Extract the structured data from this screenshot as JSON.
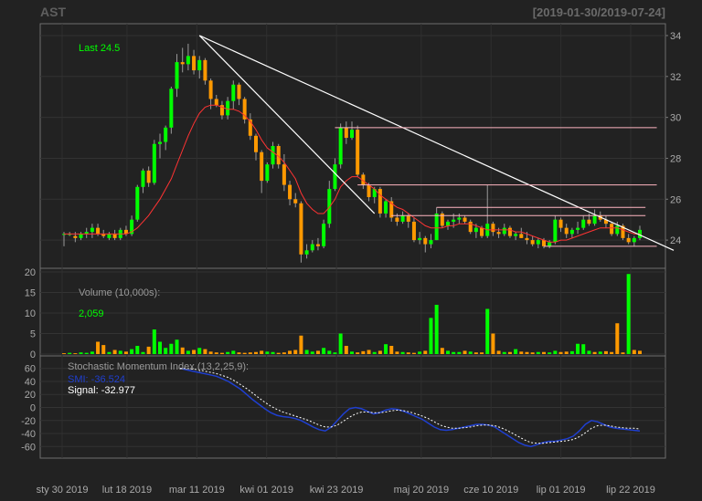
{
  "header": {
    "ticker": "AST",
    "date_range": "[2019-01-30/2019-07-24]"
  },
  "price_panel": {
    "last_label": "Last 24.5",
    "y_ticks": [
      "34",
      "32",
      "30",
      "28",
      "26",
      "24"
    ]
  },
  "volume_panel": {
    "title": "Volume (10,000s):",
    "last_value": "2,059",
    "y_ticks": [
      "20",
      "15",
      "10",
      "5",
      "0"
    ]
  },
  "smi_panel": {
    "title": "Stochastic Momentum Index (13,2,25,9):",
    "smi_label": "SMI: -36.524",
    "signal_label": "Signal: -32.977",
    "y_ticks": [
      "60",
      "40",
      "20",
      "0",
      "-20",
      "-40",
      "-60"
    ]
  },
  "x_axis": {
    "labels": [
      "sty 30 2019",
      "lut 18 2019",
      "mar 11 2019",
      "kwi 01 2019",
      "kwi 23 2019",
      "maj 20 2019",
      "cze 10 2019",
      "lip 01 2019",
      "lip 22 2019"
    ]
  },
  "colors": {
    "background": "#222222",
    "panel_border": "#777777",
    "up_candle": "#00ff00",
    "down_candle": "#ff9900",
    "ma_line": "#ff3333",
    "trend_line": "#ffffff",
    "resistance_line": "#ffb6c1",
    "smi_line": "#1f3fd0",
    "signal_line": "#ffffff"
  },
  "chart_data": {
    "type": "candlestick",
    "price": {
      "ylim": [
        22.8,
        34.4
      ],
      "last": 24.5,
      "candles": [
        {
          "o": 24.3,
          "h": 24.4,
          "l": 23.7,
          "c": 24.3
        },
        {
          "o": 24.3,
          "h": 24.4,
          "l": 24.2,
          "c": 24.3
        },
        {
          "o": 24.2,
          "h": 24.4,
          "l": 23.9,
          "c": 24.1
        },
        {
          "o": 24.1,
          "h": 24.4,
          "l": 24.0,
          "c": 24.3
        },
        {
          "o": 24.3,
          "h": 24.6,
          "l": 24.1,
          "c": 24.4
        },
        {
          "o": 24.4,
          "h": 24.8,
          "l": 24.1,
          "c": 24.6
        },
        {
          "o": 24.6,
          "h": 24.8,
          "l": 24.2,
          "c": 24.3
        },
        {
          "o": 24.3,
          "h": 24.5,
          "l": 24.1,
          "c": 24.2
        },
        {
          "o": 24.1,
          "h": 24.4,
          "l": 24.0,
          "c": 24.3
        },
        {
          "o": 24.3,
          "h": 24.5,
          "l": 24.0,
          "c": 24.1
        },
        {
          "o": 24.1,
          "h": 24.6,
          "l": 24.0,
          "c": 24.5
        },
        {
          "o": 24.5,
          "h": 24.7,
          "l": 24.2,
          "c": 24.3
        },
        {
          "o": 24.3,
          "h": 25.2,
          "l": 24.2,
          "c": 25.0
        },
        {
          "o": 25.0,
          "h": 26.7,
          "l": 24.9,
          "c": 26.6
        },
        {
          "o": 26.6,
          "h": 27.5,
          "l": 26.3,
          "c": 27.4
        },
        {
          "o": 27.4,
          "h": 27.6,
          "l": 26.6,
          "c": 26.8
        },
        {
          "o": 26.8,
          "h": 28.9,
          "l": 26.7,
          "c": 28.7
        },
        {
          "o": 28.7,
          "h": 29.2,
          "l": 28.0,
          "c": 28.8
        },
        {
          "o": 28.8,
          "h": 29.6,
          "l": 28.4,
          "c": 29.5
        },
        {
          "o": 29.5,
          "h": 31.5,
          "l": 29.2,
          "c": 31.4
        },
        {
          "o": 31.4,
          "h": 33.1,
          "l": 31.0,
          "c": 32.7
        },
        {
          "o": 32.7,
          "h": 33.4,
          "l": 32.2,
          "c": 32.6
        },
        {
          "o": 32.6,
          "h": 33.6,
          "l": 32.3,
          "c": 33.0
        },
        {
          "o": 33.0,
          "h": 33.3,
          "l": 32.1,
          "c": 32.3
        },
        {
          "o": 32.3,
          "h": 33.0,
          "l": 31.9,
          "c": 32.8
        },
        {
          "o": 32.8,
          "h": 32.9,
          "l": 31.6,
          "c": 31.8
        },
        {
          "o": 31.8,
          "h": 31.9,
          "l": 30.4,
          "c": 30.9
        },
        {
          "o": 30.9,
          "h": 31.1,
          "l": 30.5,
          "c": 30.6
        },
        {
          "o": 30.6,
          "h": 30.8,
          "l": 29.9,
          "c": 30.1
        },
        {
          "o": 30.1,
          "h": 31.0,
          "l": 29.9,
          "c": 30.8
        },
        {
          "o": 30.8,
          "h": 31.8,
          "l": 30.4,
          "c": 31.6
        },
        {
          "o": 31.6,
          "h": 31.7,
          "l": 30.6,
          "c": 30.9
        },
        {
          "o": 30.9,
          "h": 31.0,
          "l": 29.7,
          "c": 29.9
        },
        {
          "o": 29.9,
          "h": 30.2,
          "l": 28.9,
          "c": 29.1
        },
        {
          "o": 29.1,
          "h": 29.2,
          "l": 27.9,
          "c": 28.3
        },
        {
          "o": 28.3,
          "h": 28.4,
          "l": 26.3,
          "c": 26.9
        },
        {
          "o": 26.9,
          "h": 27.8,
          "l": 26.8,
          "c": 27.7
        },
        {
          "o": 27.7,
          "h": 28.8,
          "l": 27.5,
          "c": 28.6
        },
        {
          "o": 28.6,
          "h": 28.7,
          "l": 27.5,
          "c": 27.7
        },
        {
          "o": 27.7,
          "h": 28.2,
          "l": 26.4,
          "c": 26.7
        },
        {
          "o": 26.7,
          "h": 26.9,
          "l": 25.7,
          "c": 26.0
        },
        {
          "o": 26.0,
          "h": 26.3,
          "l": 25.6,
          "c": 25.8
        },
        {
          "o": 25.8,
          "h": 25.9,
          "l": 22.9,
          "c": 23.3
        },
        {
          "o": 23.3,
          "h": 23.8,
          "l": 23.1,
          "c": 23.5
        },
        {
          "o": 23.5,
          "h": 24.0,
          "l": 23.4,
          "c": 23.8
        },
        {
          "o": 23.8,
          "h": 24.1,
          "l": 23.5,
          "c": 23.7
        },
        {
          "o": 23.7,
          "h": 25.0,
          "l": 23.6,
          "c": 24.8
        },
        {
          "o": 24.8,
          "h": 26.9,
          "l": 24.6,
          "c": 26.5
        },
        {
          "o": 26.5,
          "h": 28.0,
          "l": 26.4,
          "c": 27.7
        },
        {
          "o": 27.7,
          "h": 29.7,
          "l": 27.5,
          "c": 29.5
        },
        {
          "o": 29.5,
          "h": 29.8,
          "l": 28.7,
          "c": 29.0
        },
        {
          "o": 29.0,
          "h": 29.8,
          "l": 28.9,
          "c": 29.4
        },
        {
          "o": 29.4,
          "h": 29.6,
          "l": 27.1,
          "c": 27.2
        },
        {
          "o": 27.2,
          "h": 27.3,
          "l": 26.5,
          "c": 26.7
        },
        {
          "o": 26.7,
          "h": 26.8,
          "l": 25.9,
          "c": 26.1
        },
        {
          "o": 26.1,
          "h": 26.6,
          "l": 25.8,
          "c": 26.5
        },
        {
          "o": 26.5,
          "h": 26.6,
          "l": 25.1,
          "c": 25.3
        },
        {
          "o": 25.3,
          "h": 26.0,
          "l": 25.1,
          "c": 25.9
        },
        {
          "o": 25.9,
          "h": 26.1,
          "l": 24.9,
          "c": 25.1
        },
        {
          "o": 25.1,
          "h": 25.3,
          "l": 24.7,
          "c": 24.9
        },
        {
          "o": 24.9,
          "h": 25.4,
          "l": 24.8,
          "c": 25.2
        },
        {
          "o": 25.2,
          "h": 25.3,
          "l": 24.6,
          "c": 24.9
        },
        {
          "o": 24.9,
          "h": 25.1,
          "l": 23.9,
          "c": 24.0
        },
        {
          "o": 24.0,
          "h": 24.4,
          "l": 23.8,
          "c": 24.1
        },
        {
          "o": 24.1,
          "h": 24.2,
          "l": 23.4,
          "c": 23.8
        },
        {
          "o": 23.8,
          "h": 24.3,
          "l": 23.6,
          "c": 24.0
        },
        {
          "o": 24.0,
          "h": 25.6,
          "l": 24.0,
          "c": 25.3
        },
        {
          "o": 25.3,
          "h": 25.4,
          "l": 24.6,
          "c": 24.7
        },
        {
          "o": 24.7,
          "h": 25.0,
          "l": 24.5,
          "c": 24.9
        },
        {
          "o": 24.9,
          "h": 25.3,
          "l": 24.6,
          "c": 25.0
        },
        {
          "o": 25.0,
          "h": 25.3,
          "l": 24.8,
          "c": 25.1
        },
        {
          "o": 25.1,
          "h": 25.2,
          "l": 24.8,
          "c": 24.9
        },
        {
          "o": 24.9,
          "h": 25.0,
          "l": 24.3,
          "c": 24.4
        },
        {
          "o": 24.4,
          "h": 24.8,
          "l": 24.1,
          "c": 24.6
        },
        {
          "o": 24.6,
          "h": 24.7,
          "l": 24.1,
          "c": 24.2
        },
        {
          "o": 24.2,
          "h": 26.7,
          "l": 24.1,
          "c": 24.8
        },
        {
          "o": 24.8,
          "h": 24.9,
          "l": 24.2,
          "c": 24.4
        },
        {
          "o": 24.4,
          "h": 24.6,
          "l": 24.1,
          "c": 24.3
        },
        {
          "o": 24.3,
          "h": 24.8,
          "l": 24.2,
          "c": 24.6
        },
        {
          "o": 24.6,
          "h": 24.7,
          "l": 24.1,
          "c": 24.2
        },
        {
          "o": 24.2,
          "h": 24.4,
          "l": 24.0,
          "c": 24.3
        },
        {
          "o": 24.3,
          "h": 24.6,
          "l": 24.1,
          "c": 24.1
        },
        {
          "o": 24.1,
          "h": 24.4,
          "l": 23.8,
          "c": 24.0
        },
        {
          "o": 24.0,
          "h": 24.2,
          "l": 23.7,
          "c": 23.8
        },
        {
          "o": 23.8,
          "h": 24.1,
          "l": 23.6,
          "c": 24.0
        },
        {
          "o": 24.0,
          "h": 24.1,
          "l": 23.6,
          "c": 23.7
        },
        {
          "o": 23.7,
          "h": 24.0,
          "l": 23.6,
          "c": 23.9
        },
        {
          "o": 23.9,
          "h": 25.2,
          "l": 23.8,
          "c": 25.0
        },
        {
          "o": 25.0,
          "h": 25.1,
          "l": 24.4,
          "c": 24.6
        },
        {
          "o": 24.6,
          "h": 24.8,
          "l": 24.1,
          "c": 24.3
        },
        {
          "o": 24.3,
          "h": 24.6,
          "l": 24.1,
          "c": 24.5
        },
        {
          "o": 24.5,
          "h": 24.9,
          "l": 24.3,
          "c": 24.6
        },
        {
          "o": 24.6,
          "h": 25.2,
          "l": 24.5,
          "c": 25.0
        },
        {
          "o": 25.0,
          "h": 25.3,
          "l": 24.7,
          "c": 24.8
        },
        {
          "o": 24.8,
          "h": 25.5,
          "l": 24.7,
          "c": 25.2
        },
        {
          "o": 25.2,
          "h": 25.4,
          "l": 24.9,
          "c": 25.0
        },
        {
          "o": 25.0,
          "h": 25.2,
          "l": 24.6,
          "c": 24.8
        },
        {
          "o": 24.8,
          "h": 24.9,
          "l": 24.2,
          "c": 24.3
        },
        {
          "o": 24.3,
          "h": 24.9,
          "l": 24.2,
          "c": 24.7
        },
        {
          "o": 24.7,
          "h": 24.8,
          "l": 24.0,
          "c": 24.1
        },
        {
          "o": 24.1,
          "h": 24.3,
          "l": 23.8,
          "c": 23.9
        },
        {
          "o": 23.9,
          "h": 24.2,
          "l": 23.7,
          "c": 24.1
        },
        {
          "o": 24.1,
          "h": 24.7,
          "l": 24.0,
          "c": 24.5
        }
      ],
      "moving_average": [
        24.3,
        24.3,
        24.3,
        24.3,
        24.3,
        24.3,
        24.3,
        24.3,
        24.3,
        24.3,
        24.3,
        24.3,
        24.4,
        24.6,
        24.9,
        25.2,
        25.6,
        26.0,
        26.5,
        27.0,
        27.7,
        28.4,
        29.1,
        29.7,
        30.2,
        30.5,
        30.6,
        30.6,
        30.5,
        30.4,
        30.4,
        30.3,
        30.1,
        29.8,
        29.4,
        28.9,
        28.5,
        28.3,
        28.1,
        27.8,
        27.4,
        27.0,
        26.3,
        25.8,
        25.5,
        25.3,
        25.3,
        25.6,
        26.0,
        26.6,
        26.9,
        27.1,
        27.1,
        26.9,
        26.7,
        26.5,
        26.2,
        26.0,
        25.8,
        25.6,
        25.5,
        25.3,
        25.1,
        24.9,
        24.7,
        24.6,
        24.6,
        24.6,
        24.7,
        24.7,
        24.8,
        24.8,
        24.8,
        24.7,
        24.6,
        24.5,
        24.5,
        24.5,
        24.5,
        24.5,
        24.4,
        24.4,
        24.3,
        24.2,
        24.1,
        24.0,
        23.9,
        23.9,
        24.0,
        24.0,
        24.1,
        24.2,
        24.3,
        24.4,
        24.5,
        24.6,
        24.6,
        24.6,
        24.6,
        24.5,
        24.4,
        24.3,
        24.3,
        24.2
      ],
      "trend_lines": [
        {
          "x1": 24,
          "y1": 34.0,
          "x2": 108,
          "y2": 23.5
        },
        {
          "x1": 24,
          "y1": 34.0,
          "x2": 55,
          "y2": 25.3
        }
      ],
      "resistance_lines": [
        {
          "x1": 48,
          "x2": 105,
          "y": 29.5
        },
        {
          "x1": 52,
          "x2": 105,
          "y": 26.7
        },
        {
          "x1": 66,
          "x2": 103,
          "y": 25.6
        },
        {
          "x1": 58,
          "x2": 103,
          "y": 25.2
        },
        {
          "x1": 85,
          "x2": 105,
          "y": 23.7
        }
      ]
    },
    "volume": {
      "ylim": [
        0,
        20
      ],
      "values": [
        0.2,
        0.3,
        0.2,
        0.4,
        0.3,
        0.6,
        3.0,
        2.2,
        0.5,
        1.0,
        0.8,
        0.6,
        1.2,
        2.0,
        0.5,
        1.8,
        6.0,
        3.0,
        1.5,
        2.5,
        3.5,
        1.6,
        0.8,
        1.0,
        1.5,
        1.2,
        0.6,
        0.4,
        0.3,
        0.5,
        0.8,
        0.4,
        0.3,
        0.4,
        0.5,
        0.8,
        0.6,
        0.5,
        0.3,
        0.4,
        0.8,
        1.0,
        4.5,
        1.0,
        0.6,
        0.8,
        1.5,
        0.8,
        0.4,
        5.0,
        2.0,
        0.6,
        0.4,
        0.7,
        1.0,
        0.5,
        0.8,
        2.4,
        2.0,
        0.6,
        0.5,
        0.4,
        0.3,
        0.6,
        0.8,
        8.8,
        12.0,
        1.5,
        0.8,
        0.5,
        0.5,
        0.8,
        0.6,
        0.4,
        0.4,
        11.0,
        5.0,
        0.8,
        0.5,
        0.5,
        1.2,
        0.6,
        0.5,
        0.4,
        0.5,
        0.5,
        0.4,
        0.8,
        0.5,
        0.6,
        0.7,
        2.5,
        2.4,
        0.8,
        0.5,
        0.6,
        0.7,
        0.5,
        7.5,
        0.4,
        19.5,
        1.0,
        0.8,
        0.5,
        0.4,
        0.6,
        0.5,
        0.5
      ],
      "up": [
        false,
        true,
        false,
        true,
        true,
        true,
        false,
        false,
        true,
        false,
        true,
        false,
        true,
        true,
        true,
        false,
        true,
        true,
        true,
        true,
        true,
        false,
        true,
        false,
        true,
        false,
        false,
        false,
        false,
        true,
        true,
        false,
        false,
        false,
        false,
        false,
        true,
        true,
        false,
        false,
        false,
        false,
        false,
        true,
        true,
        false,
        true,
        true,
        true,
        true,
        false,
        true,
        false,
        false,
        false,
        true,
        false,
        true,
        false,
        false,
        true,
        false,
        false,
        true,
        false,
        true,
        true,
        false,
        true,
        true,
        true,
        false,
        true,
        false,
        false,
        true,
        false,
        false,
        true,
        false,
        true,
        false,
        false,
        false,
        true,
        false,
        true,
        true,
        false,
        false,
        true,
        true,
        true,
        true,
        false,
        true,
        false,
        false,
        false,
        false,
        true,
        false,
        false,
        true,
        true
      ],
      "last": 2059
    },
    "smi": {
      "ylim": [
        -75,
        75
      ],
      "smi": [
        60,
        58,
        56,
        54,
        52,
        50,
        48,
        44,
        40,
        34,
        28,
        20,
        12,
        5,
        -2,
        -8,
        -12,
        -14,
        -15,
        -17,
        -20,
        -25,
        -30,
        -34,
        -36,
        -30,
        -20,
        -10,
        -2,
        0,
        -2,
        -6,
        -10,
        -8,
        -4,
        -2,
        -3,
        -6,
        -10,
        -14,
        -18,
        -24,
        -30,
        -34,
        -35,
        -34,
        -32,
        -30,
        -28,
        -26,
        -26,
        -27,
        -30,
        -36,
        -42,
        -48,
        -54,
        -58,
        -60,
        -57,
        -54,
        -52,
        -52,
        -50,
        -48,
        -44,
        -36,
        -26,
        -20,
        -22,
        -26,
        -30,
        -32,
        -33,
        -34,
        -35,
        -36
      ],
      "signal": [
        60,
        60,
        59,
        58,
        56,
        54,
        52,
        49,
        46,
        41,
        35,
        29,
        22,
        15,
        8,
        2,
        -3,
        -7,
        -10,
        -13,
        -16,
        -19,
        -23,
        -27,
        -30,
        -30,
        -27,
        -21,
        -15,
        -10,
        -7,
        -7,
        -8,
        -8,
        -7,
        -5,
        -4,
        -5,
        -7,
        -10,
        -13,
        -17,
        -22,
        -27,
        -30,
        -32,
        -32,
        -31,
        -30,
        -28,
        -27,
        -27,
        -28,
        -31,
        -35,
        -40,
        -45,
        -50,
        -54,
        -55,
        -55,
        -54,
        -53,
        -52,
        -51,
        -49,
        -45,
        -39,
        -32,
        -28,
        -27,
        -28,
        -30,
        -31,
        -32,
        -32,
        -33
      ],
      "smi_value": -36.524,
      "signal_value": -32.977
    }
  }
}
